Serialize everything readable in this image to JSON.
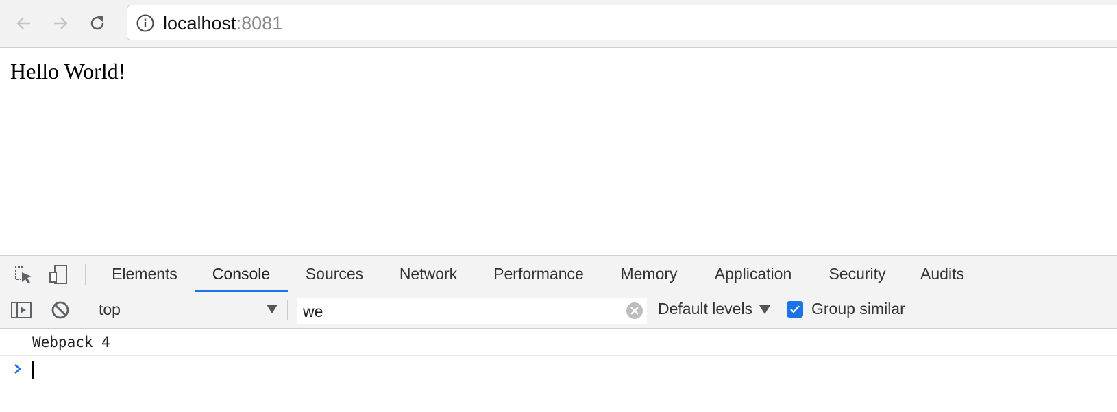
{
  "browser": {
    "url_host": "localhost",
    "url_port": ":8081",
    "icons": {
      "back": "arrow-left-icon",
      "forward": "arrow-right-icon",
      "reload": "reload-icon",
      "info": "info-icon"
    }
  },
  "page": {
    "heading": "Hello World!"
  },
  "devtools": {
    "tabs": [
      {
        "label": "Elements"
      },
      {
        "label": "Console"
      },
      {
        "label": "Sources"
      },
      {
        "label": "Network"
      },
      {
        "label": "Performance"
      },
      {
        "label": "Memory"
      },
      {
        "label": "Application"
      },
      {
        "label": "Security"
      },
      {
        "label": "Audits"
      }
    ],
    "active_tab": "Console",
    "accent_color": "#1a73e8",
    "console_toolbar": {
      "context_value": "top",
      "filter_value": "we",
      "levels_label": "Default levels",
      "group_similar_label": "Group similar",
      "group_similar_checked": true
    },
    "messages": [
      {
        "text": "Webpack 4"
      }
    ],
    "prompt_symbol": ">"
  }
}
